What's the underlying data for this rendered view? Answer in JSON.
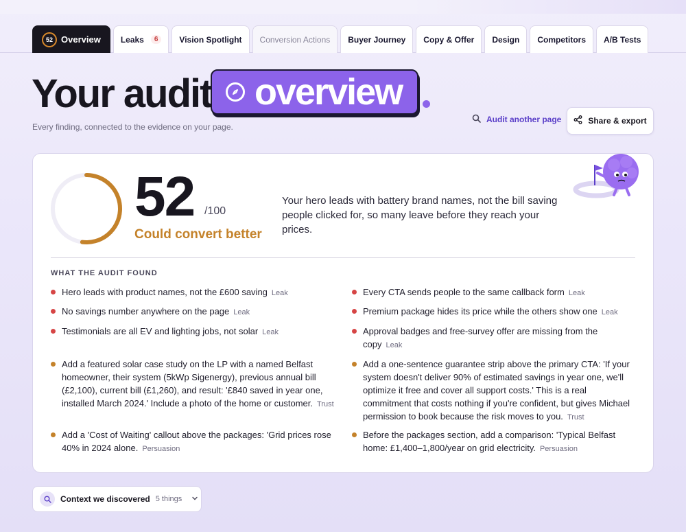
{
  "tabs": [
    {
      "label": "Overview",
      "score": "52",
      "active": true
    },
    {
      "label": "Leaks",
      "badge": "6"
    },
    {
      "label": "Vision Spotlight"
    },
    {
      "label": "Conversion Actions",
      "muted": true
    },
    {
      "label": "Buyer Journey"
    },
    {
      "label": "Copy & Offer"
    },
    {
      "label": "Design"
    },
    {
      "label": "Competitors"
    },
    {
      "label": "A/B Tests"
    }
  ],
  "heading": {
    "title_part1": "Your audit",
    "title_highlight": "overview",
    "subtitle": "Every finding, connected to the evidence on your page."
  },
  "actions": {
    "audit_another": "Audit another page",
    "share_export": "Share & export"
  },
  "score": {
    "value": "52",
    "max": "/100",
    "fraction": 0.52,
    "status": "Could convert better",
    "summary": "Your hero leads with battery brand names, not the bill saving people clicked for, so many leave before they reach your prices."
  },
  "findings_label": "WHAT THE AUDIT FOUND",
  "findings": [
    {
      "text": "Hero leads with product names, not the £600 saving",
      "tag": "Leak",
      "color": "#d64545"
    },
    {
      "text": "Every CTA sends people to the same callback form",
      "tag": "Leak",
      "color": "#d64545"
    },
    {
      "text": "No savings number anywhere on the page",
      "tag": "Leak",
      "color": "#d64545"
    },
    {
      "text": "Premium package hides its price while the others show one",
      "tag": "Leak",
      "color": "#d64545"
    },
    {
      "text": "Testimonials are all EV and lighting jobs, not solar",
      "tag": "Leak",
      "color": "#d64545"
    },
    {
      "text": "Approval badges and free-survey offer are missing from the copy",
      "tag": "Leak",
      "color": "#d64545"
    },
    {
      "text": "Add a featured solar case study on the LP with a named Belfast homeowner, their system (5kWp Sigenergy), previous annual bill (£2,100), current bill (£1,260), and result: '£840 saved in year one, installed March 2024.' Include a photo of the home or customer.",
      "tag": "Trust",
      "color": "#c4822a"
    },
    {
      "text": "Add a one-sentence guarantee strip above the primary CTA: 'If your system doesn't deliver 90% of estimated savings in year one, we'll optimize it free and cover all support costs.' This is a real commitment that costs nothing if you're confident, but gives Michael permission to book because the risk moves to you.",
      "tag": "Trust",
      "color": "#c4822a"
    },
    {
      "text": "Add a 'Cost of Waiting' callout above the packages: 'Grid prices rose 40% in 2024 alone.",
      "tag": "Persuasion",
      "color": "#c4822a"
    },
    {
      "text": "Before the packages section, add a comparison: 'Typical Belfast home: £1,400–1,800/year on grid electricity.",
      "tag": "Persuasion",
      "color": "#c4822a"
    }
  ],
  "context": {
    "label": "Context we discovered",
    "count": "5 things"
  },
  "colors": {
    "accent": "#8c63ea",
    "score_orange": "#c4822a",
    "leak_red": "#d64545"
  }
}
